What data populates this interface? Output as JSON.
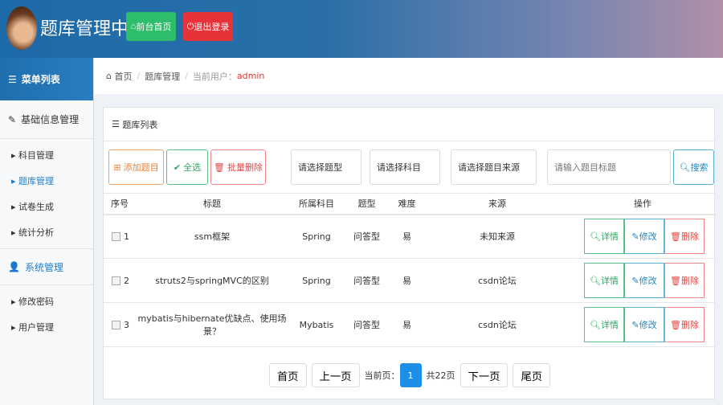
{
  "header": {
    "title": "题库管理中心",
    "home_btn": "前台首页",
    "logout_btn": "退出登录"
  },
  "sidebar": {
    "heading": "菜单列表",
    "groups": [
      {
        "label": "基础信息管理",
        "items": [
          "科目管理",
          "题库管理",
          "试卷生成",
          "统计分析"
        ]
      },
      {
        "label": "系统管理",
        "items": [
          "修改密码",
          "用户管理"
        ]
      }
    ]
  },
  "breadcrumb": {
    "home": "首页",
    "section": "题库管理",
    "user_label": "当前用户：",
    "user": "admin"
  },
  "panel": {
    "title": "题库列表",
    "add": "添加题目",
    "select_all": "全选",
    "batch_delete": "批量删除",
    "type_select": "请选择题型",
    "subject_select": "请选择科目",
    "source_select": "请选择题目来源",
    "search_placeholder": "请输入题目标题",
    "search": "搜索"
  },
  "table": {
    "headers": [
      "序号",
      "标题",
      "所属科目",
      "题型",
      "难度",
      "来源",
      "操作"
    ],
    "rows": [
      {
        "no": "1",
        "title": "ssm框架",
        "subject": "Spring",
        "type": "问答型",
        "difficulty": "易",
        "source": "未知来源"
      },
      {
        "no": "2",
        "title": "struts2与springMVC的区别",
        "subject": "Spring",
        "type": "问答型",
        "difficulty": "易",
        "source": "csdn论坛"
      },
      {
        "no": "3",
        "title": "mybatis与hibernate优缺点、使用场景？",
        "subject": "Mybatis",
        "type": "问答型",
        "difficulty": "易",
        "source": "csdn论坛"
      }
    ],
    "actions": {
      "detail": "详情",
      "edit": "修改",
      "delete": "删除"
    }
  },
  "pager": {
    "first": "首页",
    "prev": "上一页",
    "current_label": "当前页：",
    "current": "1",
    "total": "共22页",
    "next": "下一页",
    "last": "尾页"
  }
}
